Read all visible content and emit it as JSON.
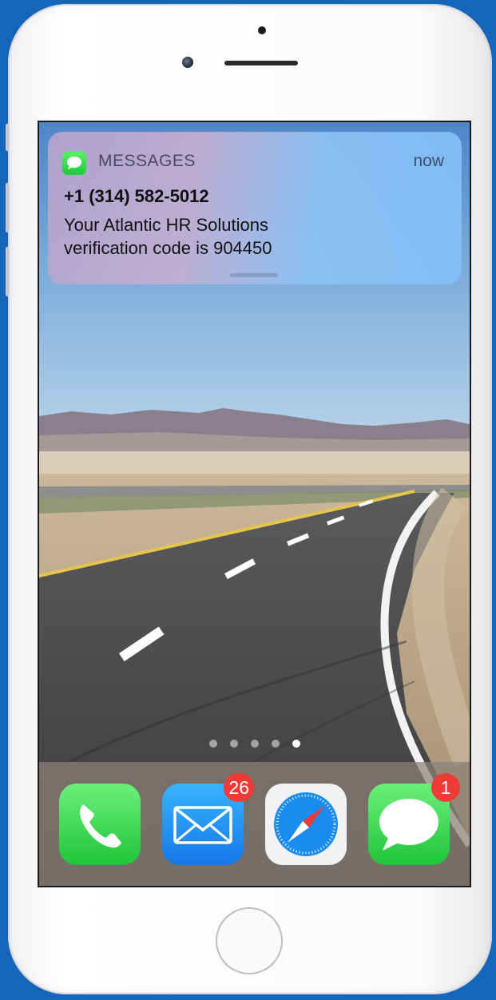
{
  "notification": {
    "app_name": "MESSAGES",
    "time": "now",
    "sender": "+1 (314) 582-5012",
    "message_line1": "Your Atlantic HR Solutions",
    "message_line2": "verification code is 904450"
  },
  "page_indicator": {
    "total": 5,
    "active_index": 4
  },
  "dock": {
    "apps": [
      {
        "name": "Phone",
        "icon": "phone-icon",
        "badge": ""
      },
      {
        "name": "Mail",
        "icon": "mail-icon",
        "badge": "26"
      },
      {
        "name": "Safari",
        "icon": "safari-compass-icon",
        "badge": ""
      },
      {
        "name": "Messages",
        "icon": "messages-bubble-icon",
        "badge": "1"
      }
    ]
  },
  "colors": {
    "background": "#1565b8",
    "badge": "#ef3b36",
    "green_app": "#2bd34a",
    "mail_blue": "#1f8ef2"
  }
}
